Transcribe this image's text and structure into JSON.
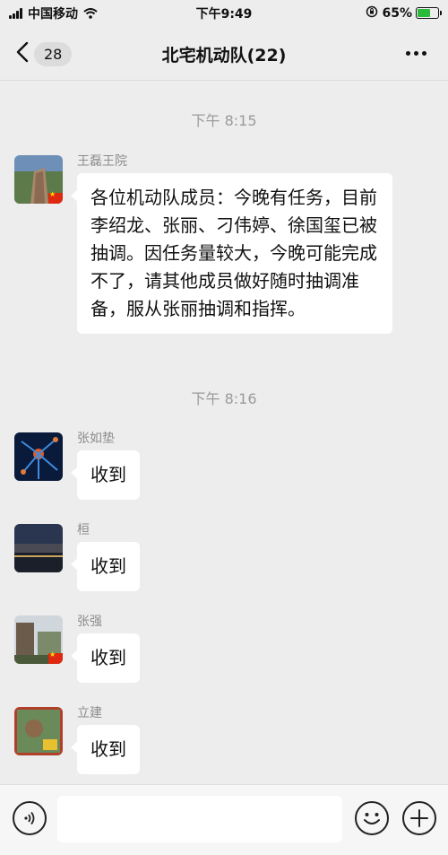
{
  "status_bar": {
    "carrier": "中国移动",
    "time": "下午9:49",
    "battery_percent": "65%",
    "battery_level": 0.65,
    "icons": [
      "signal-icon",
      "wifi-icon",
      "orientation-lock-icon",
      "battery-icon"
    ]
  },
  "nav": {
    "back_count": "28",
    "title": "北宅机动队(22)",
    "icons": [
      "back-chevron-icon",
      "more-dots-icon"
    ]
  },
  "chat": {
    "timestamps": [
      "下午 8:15",
      "下午 8:16"
    ],
    "messages": [
      {
        "sender": "王磊王院",
        "text": "各位机动队成员：今晚有任务，目前李绍龙、张丽、刁伟婷、徐国玺已被抽调。因任务量较大，今晚可能完成不了，请其他成员做好随时抽调准备，服从张丽抽调和指挥。"
      },
      {
        "sender": "张如垫",
        "text": "收到"
      },
      {
        "sender": "桓",
        "text": "收到"
      },
      {
        "sender": "张强",
        "text": "收到"
      },
      {
        "sender": "立建",
        "text": "收到"
      }
    ]
  },
  "input_bar": {
    "placeholder": "",
    "icons": [
      "voice-icon",
      "emoji-icon",
      "plus-icon"
    ]
  },
  "colors": {
    "background": "#ededed",
    "bubble": "#ffffff",
    "battery_fill": "#2bbb3a",
    "timestamp_text": "#9a9a9a"
  }
}
